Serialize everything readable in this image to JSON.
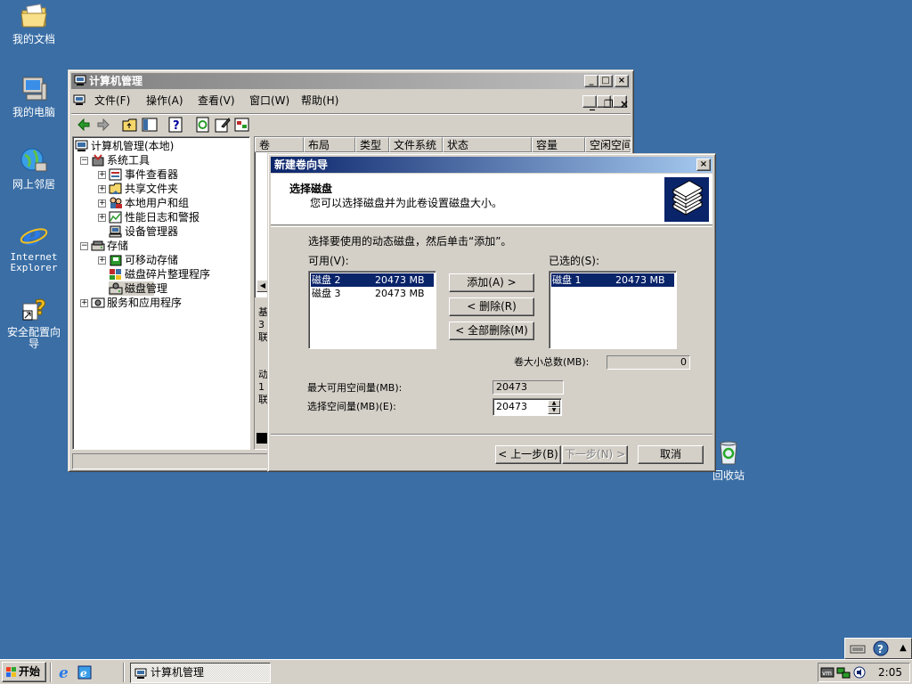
{
  "desktop": {
    "icons": [
      {
        "label": "我的文档",
        "icon": "my-documents-icon"
      },
      {
        "label": "我的电脑",
        "icon": "my-computer-icon"
      },
      {
        "label": "网上邻居",
        "icon": "network-places-icon"
      },
      {
        "label_line1": "Internet",
        "label_line2": "Explorer",
        "icon": "internet-explorer-icon"
      },
      {
        "label_line1": "安全配置向",
        "label_line2": "导",
        "icon": "security-wizard-icon"
      },
      {
        "label": "回收站",
        "icon": "recycle-bin-icon"
      }
    ]
  },
  "mmc": {
    "title": "计算机管理",
    "menu": [
      "文件(F)",
      "操作(A)",
      "查看(V)",
      "窗口(W)",
      "帮助(H)"
    ],
    "tree": {
      "root": "计算机管理(本地)",
      "system_tools": "系统工具",
      "event_viewer": "事件查看器",
      "shared_folders": "共享文件夹",
      "local_users": "本地用户和组",
      "perf_logs": "性能日志和警报",
      "device_manager": "设备管理器",
      "storage": "存储",
      "removable": "可移动存储",
      "defrag": "磁盘碎片整理程序",
      "disk_mgmt": "磁盘管理",
      "services_apps": "服务和应用程序"
    },
    "columns": [
      "卷",
      "布局",
      "类型",
      "文件系统",
      "状态",
      "容量",
      "空闲空间"
    ],
    "lower_fragments": {
      "disk0_lines": [
        "基",
        "3",
        "联"
      ],
      "disk1_lines": [
        "动",
        "1",
        "联"
      ]
    }
  },
  "wizard": {
    "title": "新建卷向导",
    "header_title": "选择磁盘",
    "header_subtitle": "您可以选择磁盘并为此卷设置磁盘大小。",
    "instruction": "选择要使用的动态磁盘，然后单击“添加”。",
    "available_label": "可用(V):",
    "selected_label": "已选的(S):",
    "available": [
      {
        "name": "磁盘 2",
        "size": "20473 MB",
        "selected": true
      },
      {
        "name": "磁盘 3",
        "size": "20473 MB",
        "selected": false
      }
    ],
    "selected": [
      {
        "name": "磁盘 1",
        "size": "20473 MB",
        "selected": true
      }
    ],
    "add_button": "添加(A) >",
    "remove_button": "< 删除(R)",
    "remove_all_button": "< 全部删除(M)",
    "total_label": "卷大小总数(MB):",
    "total_value": "0",
    "max_label": "最大可用空间量(MB):",
    "max_value": "20473",
    "select_label": "选择空间量(MB)(E):",
    "select_value": "20473",
    "back_button": "< 上一步(B)",
    "next_button": "下一步(N) >",
    "cancel_button": "取消"
  },
  "taskbar": {
    "start": "开始",
    "task_button": "计算机管理",
    "clock": "2:05"
  },
  "colors": {
    "desktop": "#3a6ea5",
    "active_title": "#0a246a",
    "face": "#d4d0c8"
  }
}
